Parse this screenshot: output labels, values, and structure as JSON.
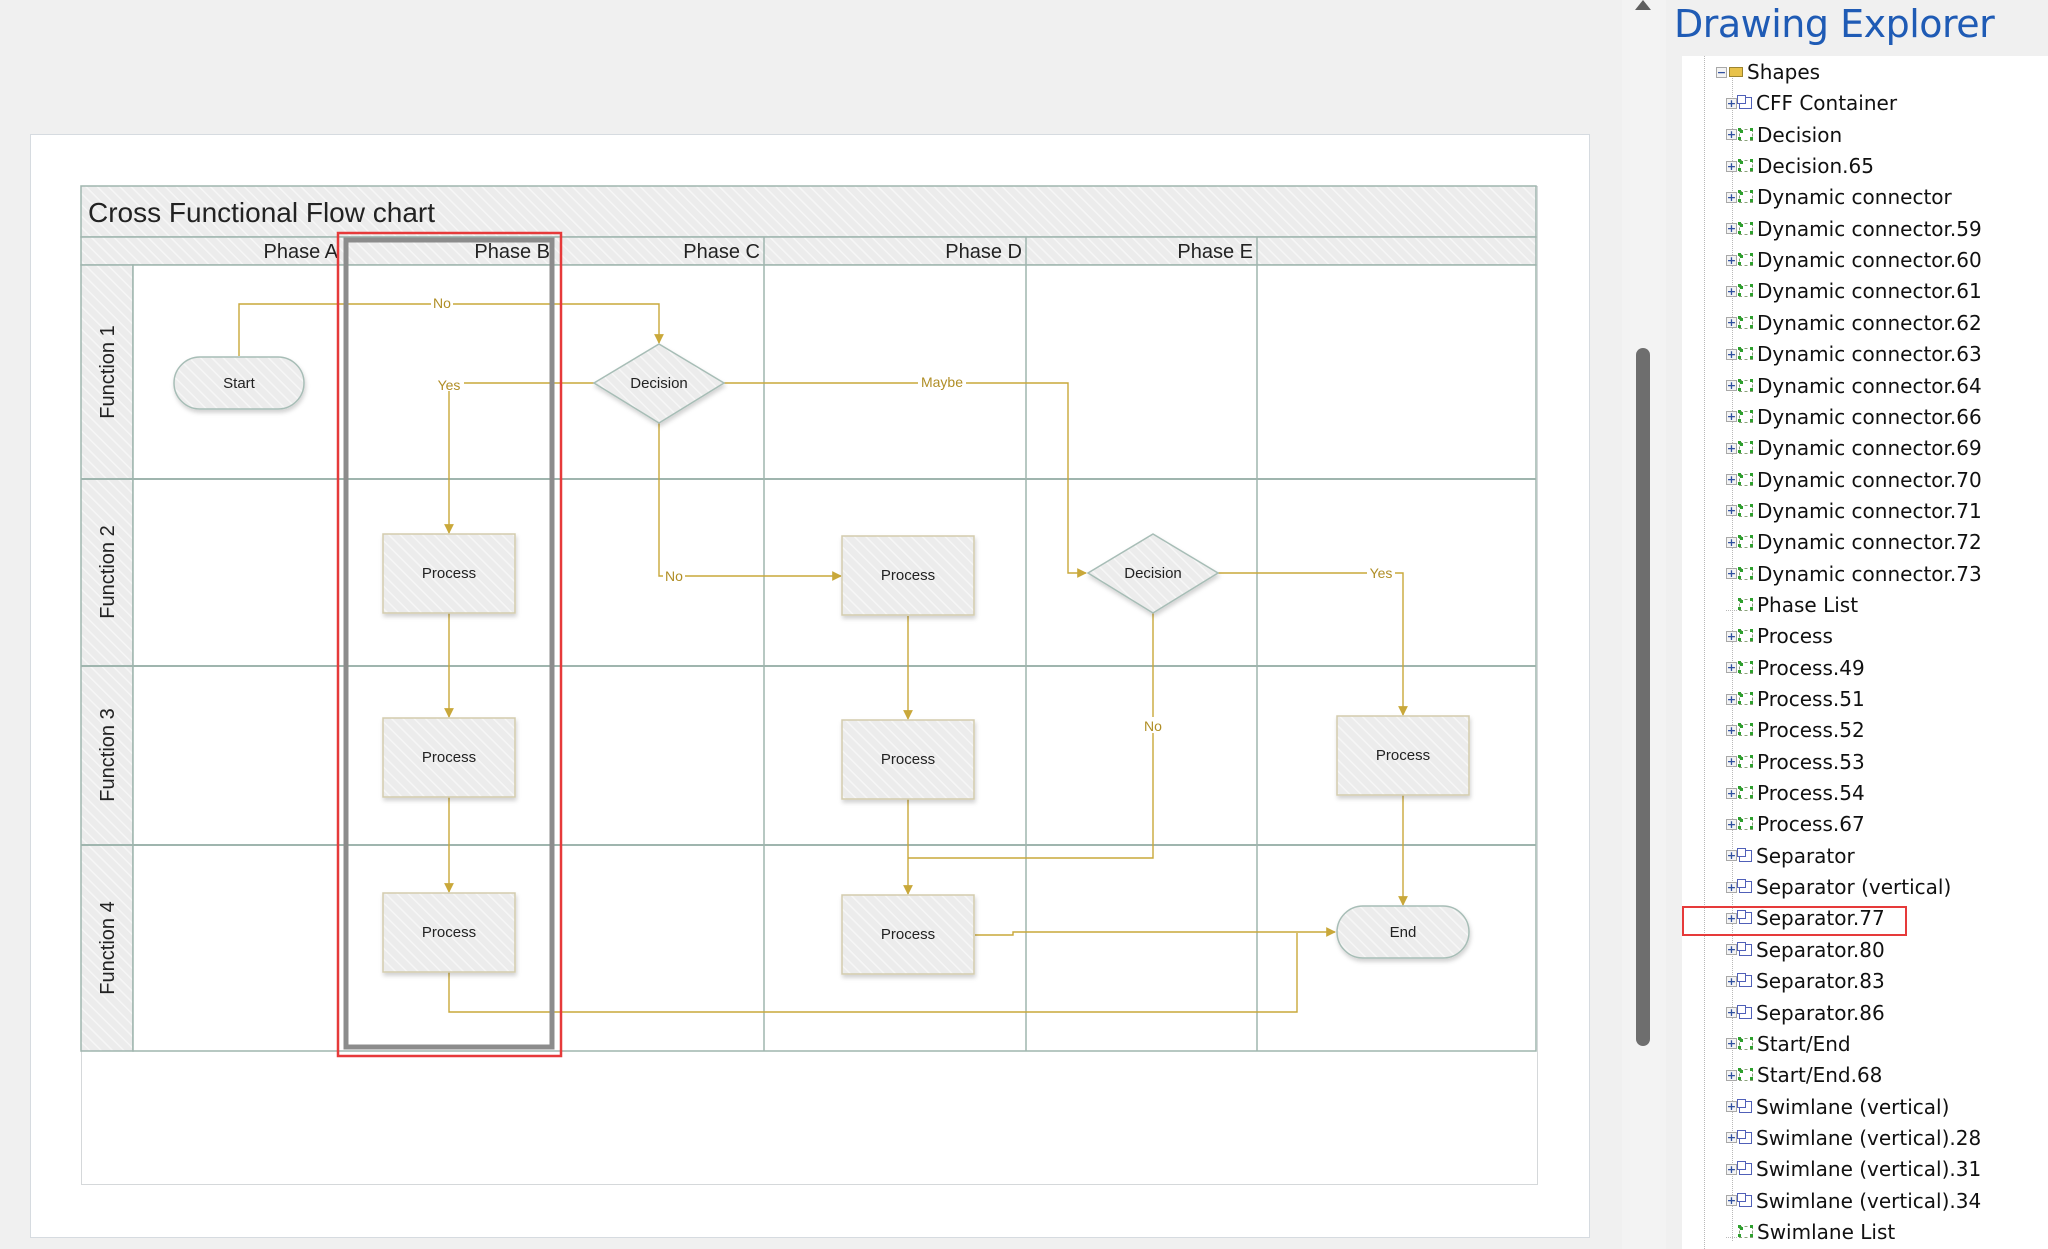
{
  "diagram": {
    "title": "Cross Functional Flow chart",
    "phases": [
      "Phase A",
      "Phase B",
      "Phase C",
      "Phase D",
      "Phase E"
    ],
    "functions": [
      "Function 1",
      "Function 2",
      "Function 3",
      "Function 4"
    ],
    "shapes": {
      "start": "Start",
      "decision1": "Decision",
      "decision2": "Decision",
      "process_b2": "Process",
      "process_b3": "Process",
      "process_b4": "Process",
      "process_d2": "Process",
      "process_d3": "Process",
      "process_d4": "Process",
      "process_e3": "Process",
      "end": "End"
    },
    "connector_labels": {
      "no_top": "No",
      "yes_left": "Yes",
      "maybe": "Maybe",
      "no_mid": "No",
      "yes_right": "Yes",
      "no_right": "No"
    },
    "selected_shape": "Separator.77",
    "colors": {
      "connector": "#c9a83a",
      "lane_border": "#9fb5ae",
      "selection_outline": "#e63a3a",
      "selected_separator": "#8c8c8c"
    }
  },
  "explorer": {
    "title": "Drawing Explorer",
    "root": {
      "label": "Shapes",
      "expanded": true,
      "icon": "folder-icon"
    },
    "items": [
      {
        "label": "CFF Container",
        "icon": "container-shape-icon",
        "expandable": true
      },
      {
        "label": "Decision",
        "icon": "shape-icon",
        "expandable": true
      },
      {
        "label": "Decision.65",
        "icon": "shape-icon",
        "expandable": true
      },
      {
        "label": "Dynamic connector",
        "icon": "shape-icon",
        "expandable": true
      },
      {
        "label": "Dynamic connector.59",
        "icon": "shape-icon",
        "expandable": true
      },
      {
        "label": "Dynamic connector.60",
        "icon": "shape-icon",
        "expandable": true
      },
      {
        "label": "Dynamic connector.61",
        "icon": "shape-icon",
        "expandable": true
      },
      {
        "label": "Dynamic connector.62",
        "icon": "shape-icon",
        "expandable": true
      },
      {
        "label": "Dynamic connector.63",
        "icon": "shape-icon",
        "expandable": true
      },
      {
        "label": "Dynamic connector.64",
        "icon": "shape-icon",
        "expandable": true
      },
      {
        "label": "Dynamic connector.66",
        "icon": "shape-icon",
        "expandable": true
      },
      {
        "label": "Dynamic connector.69",
        "icon": "shape-icon",
        "expandable": true
      },
      {
        "label": "Dynamic connector.70",
        "icon": "shape-icon",
        "expandable": true
      },
      {
        "label": "Dynamic connector.71",
        "icon": "shape-icon",
        "expandable": true
      },
      {
        "label": "Dynamic connector.72",
        "icon": "shape-icon",
        "expandable": true
      },
      {
        "label": "Dynamic connector.73",
        "icon": "shape-icon",
        "expandable": true
      },
      {
        "label": "Phase List",
        "icon": "shape-icon",
        "expandable": false
      },
      {
        "label": "Process",
        "icon": "shape-icon",
        "expandable": true
      },
      {
        "label": "Process.49",
        "icon": "shape-icon",
        "expandable": true
      },
      {
        "label": "Process.51",
        "icon": "shape-icon",
        "expandable": true
      },
      {
        "label": "Process.52",
        "icon": "shape-icon",
        "expandable": true
      },
      {
        "label": "Process.53",
        "icon": "shape-icon",
        "expandable": true
      },
      {
        "label": "Process.54",
        "icon": "shape-icon",
        "expandable": true
      },
      {
        "label": "Process.67",
        "icon": "shape-icon",
        "expandable": true
      },
      {
        "label": "Separator",
        "icon": "container-shape-icon",
        "expandable": true
      },
      {
        "label": "Separator (vertical)",
        "icon": "container-shape-icon",
        "expandable": true
      },
      {
        "label": "Separator.77",
        "icon": "container-shape-icon",
        "expandable": true,
        "highlighted": true
      },
      {
        "label": "Separator.80",
        "icon": "container-shape-icon",
        "expandable": true
      },
      {
        "label": "Separator.83",
        "icon": "container-shape-icon",
        "expandable": true
      },
      {
        "label": "Separator.86",
        "icon": "container-shape-icon",
        "expandable": true
      },
      {
        "label": "Start/End",
        "icon": "shape-icon",
        "expandable": true
      },
      {
        "label": "Start/End.68",
        "icon": "shape-icon",
        "expandable": true
      },
      {
        "label": "Swimlane (vertical)",
        "icon": "container-shape-icon",
        "expandable": true
      },
      {
        "label": "Swimlane (vertical).28",
        "icon": "container-shape-icon",
        "expandable": true
      },
      {
        "label": "Swimlane (vertical).31",
        "icon": "container-shape-icon",
        "expandable": true
      },
      {
        "label": "Swimlane (vertical).34",
        "icon": "container-shape-icon",
        "expandable": true
      },
      {
        "label": "Swimlane List",
        "icon": "shape-icon",
        "expandable": false
      }
    ]
  }
}
